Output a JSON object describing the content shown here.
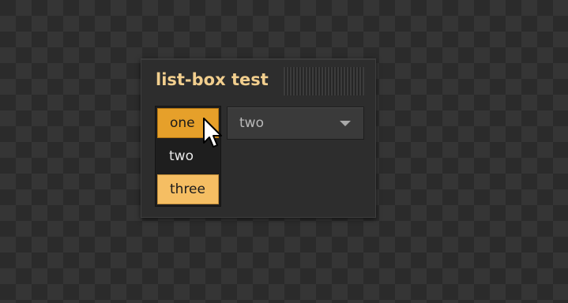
{
  "window": {
    "title": "list-box test"
  },
  "listbox": {
    "items": [
      {
        "label": "one",
        "state": "selected"
      },
      {
        "label": "two",
        "state": "normal"
      },
      {
        "label": "three",
        "state": "highlighted"
      }
    ]
  },
  "combo": {
    "value": "two",
    "icon": "chevron-down-icon"
  },
  "cursor": {
    "icon": "mouse-pointer-icon"
  },
  "colors": {
    "accent": "#e6a02a",
    "highlight": "#f5be63",
    "title": "#f2cf8e",
    "panel": "#2d2d2d"
  }
}
